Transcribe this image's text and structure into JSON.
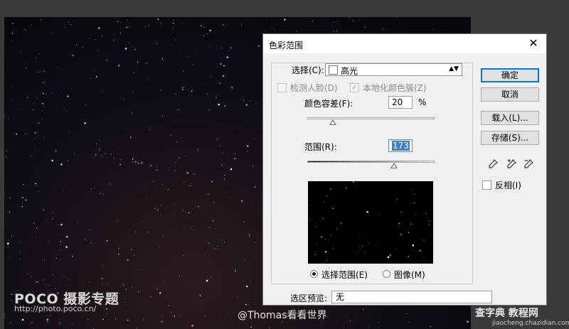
{
  "dialog": {
    "title": "色彩范围",
    "close_glyph": "✕",
    "select_label": "选择(C):",
    "select_value": "高光",
    "detect_faces_label": "检测人脸(D)",
    "localized_clusters_label": "本地化颜色簇(Z)",
    "localized_clusters_checked": true,
    "fuzziness_label": "颜色容差(F):",
    "fuzziness_value": "20",
    "fuzziness_unit": "%",
    "fuzziness_level": 0.2,
    "range_label": "范围(R):",
    "range_value": "173",
    "range_level": 0.68,
    "radio_selection_label": "选择范围(E)",
    "radio_image_label": "图像(M)",
    "radio_selected": "selection",
    "selection_preview_label": "选区预览:",
    "selection_preview_value": "无",
    "ok_label": "确定",
    "cancel_label": "取消",
    "load_label": "载入(L)...",
    "save_label": "存储(S)...",
    "invert_label": "反相(I)",
    "invert_checked": false,
    "eyedropper_icons": [
      "eyedropper-icon",
      "eyedropper-plus-icon",
      "eyedropper-minus-icon"
    ]
  },
  "watermarks": {
    "poco": "POCO 摄影专题",
    "poco_url": "http://photo.poco.cn/",
    "credit": "@Thomas看看世界",
    "site": "查字典 教程网",
    "site_url": "jiaocheng.chazidian.com"
  },
  "colors": {
    "dialog_bg": "#f0f0f0",
    "default_button_border": "#0078d7",
    "selection_highlight": "#3b7fd3"
  }
}
